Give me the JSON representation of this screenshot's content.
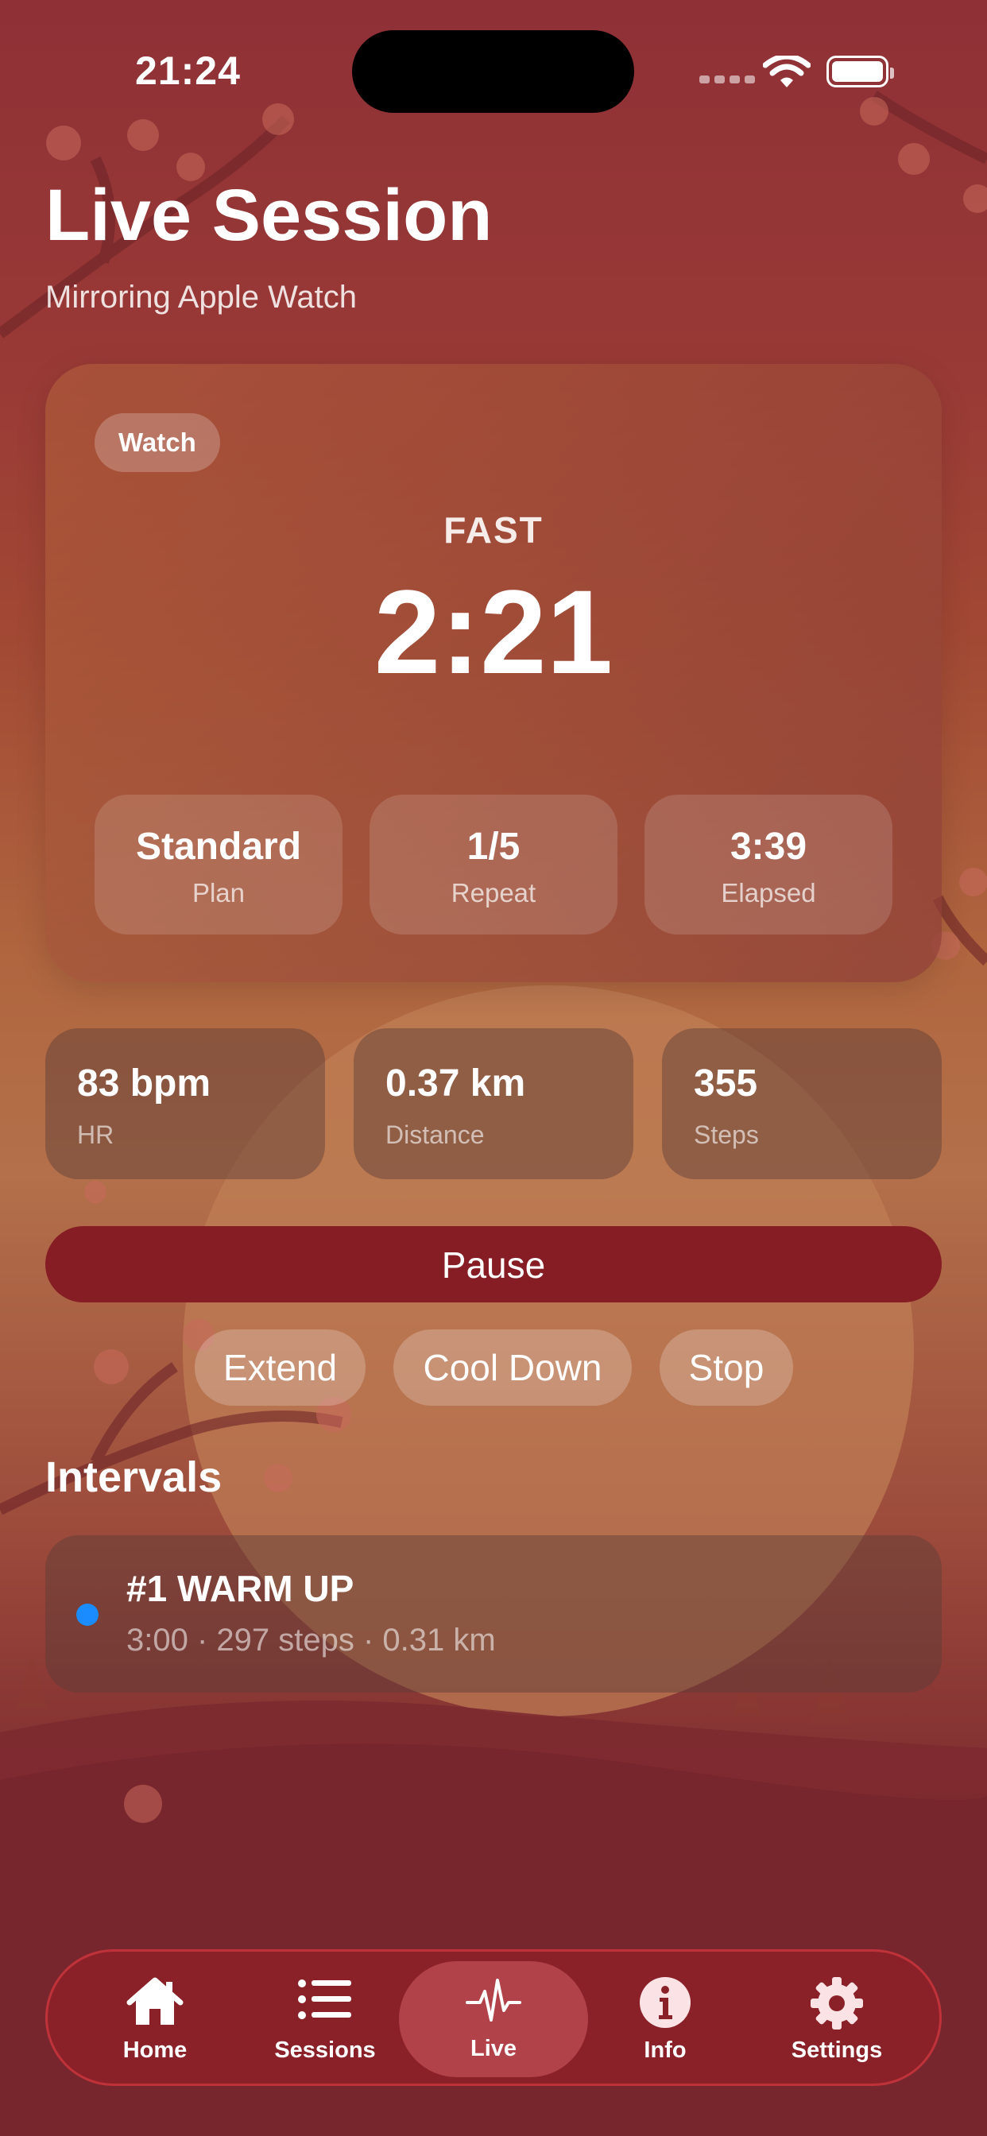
{
  "status_bar": {
    "time": "21:24"
  },
  "header": {
    "title": "Live Session",
    "subtitle": "Mirroring Apple Watch"
  },
  "session_card": {
    "badge": "Watch",
    "phase": "FAST",
    "timer": "2:21",
    "stats": [
      {
        "value": "Standard",
        "label": "Plan"
      },
      {
        "value": "1/5",
        "label": "Repeat"
      },
      {
        "value": "3:39",
        "label": "Elapsed"
      }
    ]
  },
  "metrics": [
    {
      "value": "83 bpm",
      "label": "HR"
    },
    {
      "value": "0.37 km",
      "label": "Distance"
    },
    {
      "value": "355",
      "label": "Steps"
    }
  ],
  "controls": {
    "pause": "Pause",
    "extend": "Extend",
    "cool_down": "Cool Down",
    "stop": "Stop"
  },
  "intervals": {
    "title": "Intervals",
    "items": [
      {
        "title": "#1 WARM UP",
        "detail": "3:00 · 297 steps · 0.31 km",
        "dot_color": "#1a8cff"
      }
    ]
  },
  "tabbar": {
    "items": [
      {
        "label": "Home",
        "icon": "house-icon"
      },
      {
        "label": "Sessions",
        "icon": "list-icon"
      },
      {
        "label": "Live",
        "icon": "waveform-icon"
      },
      {
        "label": "Info",
        "icon": "info-icon"
      },
      {
        "label": "Settings",
        "icon": "gear-icon"
      }
    ],
    "active": "Live"
  },
  "colors": {
    "accent": "#861d25",
    "active_tab": "#b2424a"
  }
}
